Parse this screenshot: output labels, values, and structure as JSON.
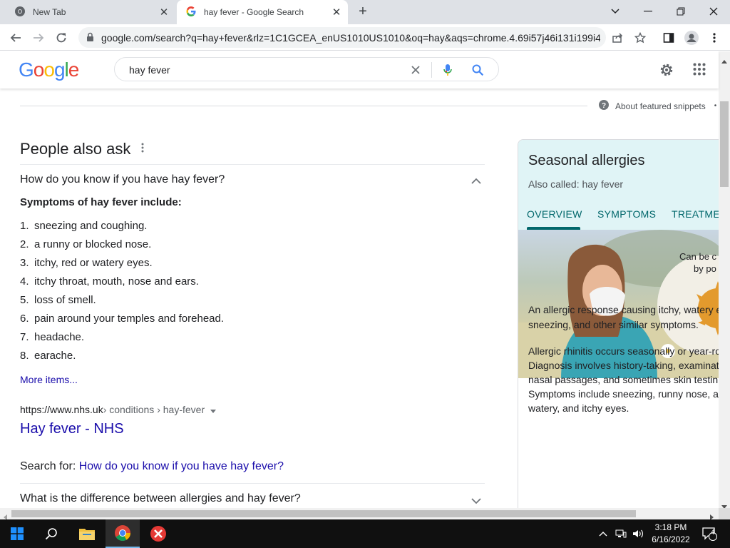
{
  "browser": {
    "tabs": [
      {
        "title": "New Tab",
        "active": false
      },
      {
        "title": "hay fever - Google Search",
        "active": true
      }
    ],
    "address": "google.com/search?q=hay+fever&rlz=1C1GCEA_enUS1010US1010&oq=hay&aqs=chrome.4.69i57j46i131i199i4..."
  },
  "search": {
    "logo": "Google",
    "query": "hay fever"
  },
  "results": {
    "featured_snippets_label": "About featured snippets",
    "paa_title": "People also ask",
    "q1": "How do you know if you have hay fever?",
    "symptoms_heading": "Symptoms of hay fever include:",
    "symptoms": [
      {
        "n": "1.",
        "text": "sneezing and coughing."
      },
      {
        "n": "2.",
        "text": "a runny or blocked nose."
      },
      {
        "n": "3.",
        "text": "itchy, red or watery eyes."
      },
      {
        "n": "4.",
        "text": "itchy throat, mouth, nose and ears."
      },
      {
        "n": "5.",
        "text": "loss of smell."
      },
      {
        "n": "6.",
        "text": "pain around your temples and forehead."
      },
      {
        "n": "7.",
        "text": "headache."
      },
      {
        "n": "8.",
        "text": "earache."
      }
    ],
    "more_items": "More items...",
    "cite_domain": "https://www.nhs.uk",
    "cite_path": " › conditions › hay-fever",
    "result_title": "Hay fever - NHS",
    "search_for_label": "Search for: ",
    "search_for_link": "How do you know if you have hay fever?",
    "q2": "What is the difference between allergies and hay fever?"
  },
  "knowledge_panel": {
    "title": "Seasonal allergies",
    "subtitle": "Also called: hay fever",
    "tabs": [
      "OVERVIEW",
      "SYMPTOMS",
      "TREATME"
    ],
    "image_caption_1": "Can be c",
    "image_caption_2": "by po",
    "text1_line1": "An allergic response causing itchy, watery e",
    "text1_line2": "sneezing, and other similar symptoms.",
    "text2_lines": [
      "Allergic rhinitis occurs seasonally or year-ro",
      "Diagnosis involves history-taking, examinati",
      "nasal passages, and sometimes skin testin",
      "Symptoms include sneezing, runny nose, a",
      "watery, and itchy eyes."
    ]
  },
  "taskbar": {
    "time": "3:18 PM",
    "date": "6/16/2022",
    "notifications": "4"
  },
  "colors": {
    "link": "#1a0dab",
    "kp_accent": "#01676b",
    "kp_header_bg": "#e0f4f6"
  }
}
